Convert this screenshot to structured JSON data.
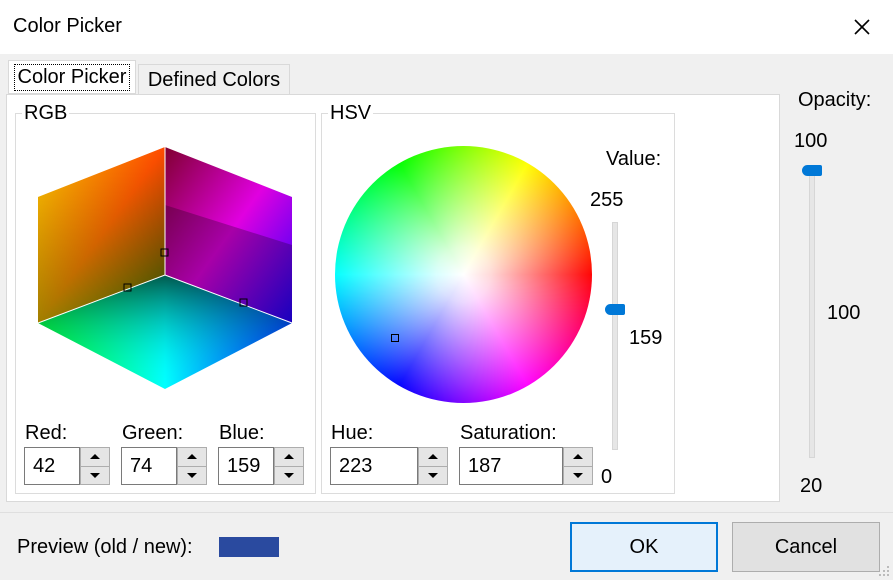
{
  "window": {
    "title": "Color Picker"
  },
  "tabs": [
    {
      "label": "Color Picker",
      "active": true
    },
    {
      "label": "Defined Colors",
      "active": false
    }
  ],
  "rgb": {
    "group_label": "RGB",
    "red_label": "Red:",
    "red_value": "42",
    "green_label": "Green:",
    "green_value": "74",
    "blue_label": "Blue:",
    "blue_value": "159"
  },
  "hsv": {
    "group_label": "HSV",
    "hue_label": "Hue:",
    "hue_value": "223",
    "saturation_label": "Saturation:",
    "saturation_value": "187",
    "value_label": "Value:",
    "value_max": "255",
    "value_current": "159",
    "value_min": "0",
    "value_level": 159
  },
  "opacity": {
    "label": "Opacity:",
    "max": "100",
    "current": "100",
    "min": "20",
    "level": 100
  },
  "preview": {
    "label": "Preview (old / new):",
    "color": "#2a4a9f"
  },
  "buttons": {
    "ok": "OK",
    "cancel": "Cancel"
  },
  "colors": {
    "accent": "#0078d7"
  }
}
